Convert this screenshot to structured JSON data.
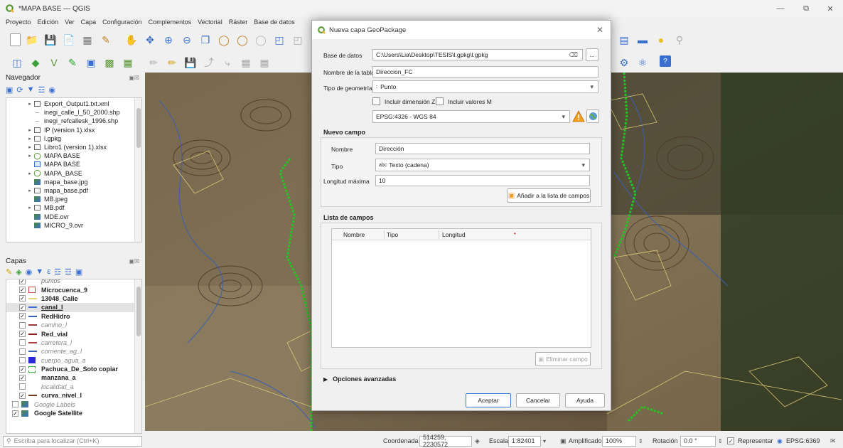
{
  "window": {
    "title": "*MAPA BASE — QGIS",
    "logo": "qgis-logo"
  },
  "menu": [
    "Proyecto",
    "Edición",
    "Ver",
    "Capa",
    "Configuración",
    "Complementos",
    "Vectorial",
    "Ráster",
    "Base de datos"
  ],
  "browser": {
    "title": "Navegador",
    "items": [
      {
        "label": "Export_Output1.txt.xml",
        "icon": "table-icon",
        "arrow": true
      },
      {
        "label": "inegi_calle_l_50_2000.shp",
        "icon": "line-layer-icon",
        "arrow": false
      },
      {
        "label": "inegi_refcallesk_1996.shp",
        "icon": "line-layer-icon",
        "arrow": false
      },
      {
        "label": "IP (version 1).xlsx",
        "icon": "table-icon",
        "arrow": true
      },
      {
        "label": "l.gpkg",
        "icon": "table-icon",
        "arrow": true
      },
      {
        "label": "Libro1 (version 1).xlsx",
        "icon": "table-icon",
        "arrow": true
      },
      {
        "label": "MAPA BASE",
        "icon": "qgis-icon",
        "arrow": true
      },
      {
        "label": "MAPA BASE",
        "icon": "layout-icon",
        "arrow": false
      },
      {
        "label": "MAPA_BASE",
        "icon": "qgis-icon",
        "arrow": true
      },
      {
        "label": "mapa_base.jpg",
        "icon": "raster-icon",
        "arrow": false
      },
      {
        "label": "mapa_base.pdf",
        "icon": "table-icon",
        "arrow": true
      },
      {
        "label": "MB.jpeg",
        "icon": "raster-icon",
        "arrow": false
      },
      {
        "label": "MB.pdf",
        "icon": "table-icon",
        "arrow": true
      },
      {
        "label": "MDE.ovr",
        "icon": "raster-icon",
        "arrow": false
      },
      {
        "label": "MICRO_9.ovr",
        "icon": "raster-icon",
        "arrow": false
      }
    ]
  },
  "layers": {
    "title": "Capas",
    "items": [
      {
        "label": "puntos",
        "checked": true,
        "sym": "none",
        "color": "#444444",
        "active": false,
        "partial": true
      },
      {
        "label": "Microcuenca_9",
        "checked": true,
        "sym": "box",
        "color": "#d04040",
        "active": true
      },
      {
        "label": "13048_Calle",
        "checked": true,
        "sym": "line",
        "color": "#e8d37a",
        "active": true
      },
      {
        "label": "canal_l",
        "checked": true,
        "sym": "line",
        "color": "#3a6fd0",
        "active": true,
        "underline": true,
        "selected": true
      },
      {
        "label": "RedHidro",
        "checked": true,
        "sym": "line",
        "color": "#3a5fb0",
        "active": true
      },
      {
        "label": "camino_l",
        "checked": false,
        "sym": "line",
        "color": "#9c3b3b",
        "active": false
      },
      {
        "label": "Red_vial",
        "checked": true,
        "sym": "line",
        "color": "#8b1f1f",
        "active": true
      },
      {
        "label": "carretera_l",
        "checked": false,
        "sym": "line",
        "color": "#b04040",
        "active": false
      },
      {
        "label": "corriente_ag_l",
        "checked": false,
        "sym": "line",
        "color": "#3a5fb0",
        "active": false
      },
      {
        "label": "cuerpo_agua_a",
        "checked": false,
        "sym": "fill",
        "color": "#2a2ad8",
        "active": false
      },
      {
        "label": "Pachuca_De_Soto copiar",
        "checked": true,
        "sym": "dashbox",
        "color": "#2aa52a",
        "active": true
      },
      {
        "label": "manzana_a",
        "checked": true,
        "sym": "none",
        "color": "#888888",
        "active": true
      },
      {
        "label": "localidad_a",
        "checked": false,
        "sym": "none",
        "color": "#888888",
        "active": false
      },
      {
        "label": "curva_nivel_l",
        "checked": true,
        "sym": "line",
        "color": "#6b3a1f",
        "active": true
      },
      {
        "label": "Google Labels",
        "checked": false,
        "sym": "raster",
        "color": "#888888",
        "active": false
      },
      {
        "label": "Google Satellite",
        "checked": true,
        "sym": "raster",
        "color": "#888888",
        "active": true
      }
    ]
  },
  "dialog": {
    "title": "Nueva capa GeoPackage",
    "base_datos_label": "Base de datos",
    "base_datos_value": "C:\\Users\\Lia\\Desktop\\TESIS\\l.gpkg\\l.gpkg",
    "browse_label": "...",
    "nombre_tabla_label": "Nombre de la tabla",
    "nombre_tabla_value": "Direccion_FC",
    "tipo_geometria_label": "Tipo de geometría",
    "tipo_geometria_value": "Punto",
    "incluir_z_label": "Incluir dimensión Z",
    "incluir_m_label": "Incluir valores M",
    "crs_value": "EPSG:4326 - WGS 84",
    "nuevo_campo_title": "Nuevo campo",
    "nombre_label": "Nombre",
    "nombre_value": "Dirección",
    "tipo_label": "Tipo",
    "tipo_prefix": "abc",
    "tipo_value": "Texto (cadena)",
    "longitud_label": "Longitud máxima",
    "longitud_value": "10",
    "add_field_label": "Añadir a la lista de campos",
    "lista_title": "Lista de campos",
    "columns": [
      "Nombre",
      "Tipo",
      "Longitud"
    ],
    "delete_field_label": "Eliminar campo",
    "advanced_label": "Opciones avanzadas",
    "ok_label": "Aceptar",
    "cancel_label": "Cancelar",
    "help_label": "Ayuda"
  },
  "status": {
    "search_placeholder": "Escriba para localizar (Ctrl+K)",
    "coord_label": "Coordenada",
    "coord_value": "514259, 2230572",
    "scale_label": "Escala",
    "scale_value": "1:82401",
    "magnifier_label": "Amplificador",
    "magnifier_value": "100%",
    "rotation_label": "Rotación",
    "rotation_value": "0.0 °",
    "render_label": "Representar",
    "crs_label": "EPSG:6369"
  },
  "colors": {
    "accent_green": "#2aa52a",
    "qgis_green": "#589632",
    "warning_orange": "#f0a020"
  }
}
